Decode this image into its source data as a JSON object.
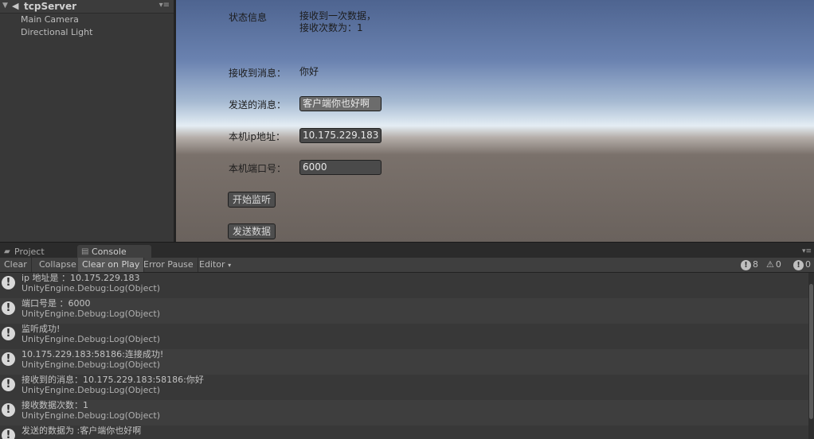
{
  "hierarchy": {
    "scene_name": "tcpServer",
    "items": [
      "Main Camera",
      "Directional Light"
    ]
  },
  "game": {
    "status_label": "状态信息",
    "status_value": "接收到一次数据，接收次数为：1",
    "received_label": "接收到消息：",
    "received_value": "你好",
    "send_label": "发送的消息：",
    "send_value": "客户端你也好啊",
    "ip_label": "本机ip地址：",
    "ip_value": "10.175.229.183",
    "port_label": "本机端口号：",
    "port_value": "6000",
    "listen_button": "开始监听",
    "send_button": "发送数据"
  },
  "tabs": {
    "project": "Project",
    "console": "Console"
  },
  "toolbar": {
    "clear": "Clear",
    "collapse": "Collapse",
    "clear_on_play": "Clear on Play",
    "error_pause": "Error Pause",
    "editor": "Editor",
    "log_count": "8",
    "warn_count": "0",
    "error_count": "0"
  },
  "log": [
    {
      "line1": " ip 地址是 ：10.175.229.183",
      "line2": "UnityEngine.Debug:Log(Object)"
    },
    {
      "line1": " 端口号是 ：6000",
      "line2": "UnityEngine.Debug:Log(Object)"
    },
    {
      "line1": "监听成功!",
      "line2": "UnityEngine.Debug:Log(Object)"
    },
    {
      "line1": "10.175.229.183:58186:连接成功!",
      "line2": "UnityEngine.Debug:Log(Object)"
    },
    {
      "line1": "接收到的消息：10.175.229.183:58186:你好",
      "line2": "UnityEngine.Debug:Log(Object)"
    },
    {
      "line1": "接收数据次数：1",
      "line2": "UnityEngine.Debug:Log(Object)"
    },
    {
      "line1": "发送的数据为 :客户端你也好啊",
      "line2": ""
    }
  ]
}
